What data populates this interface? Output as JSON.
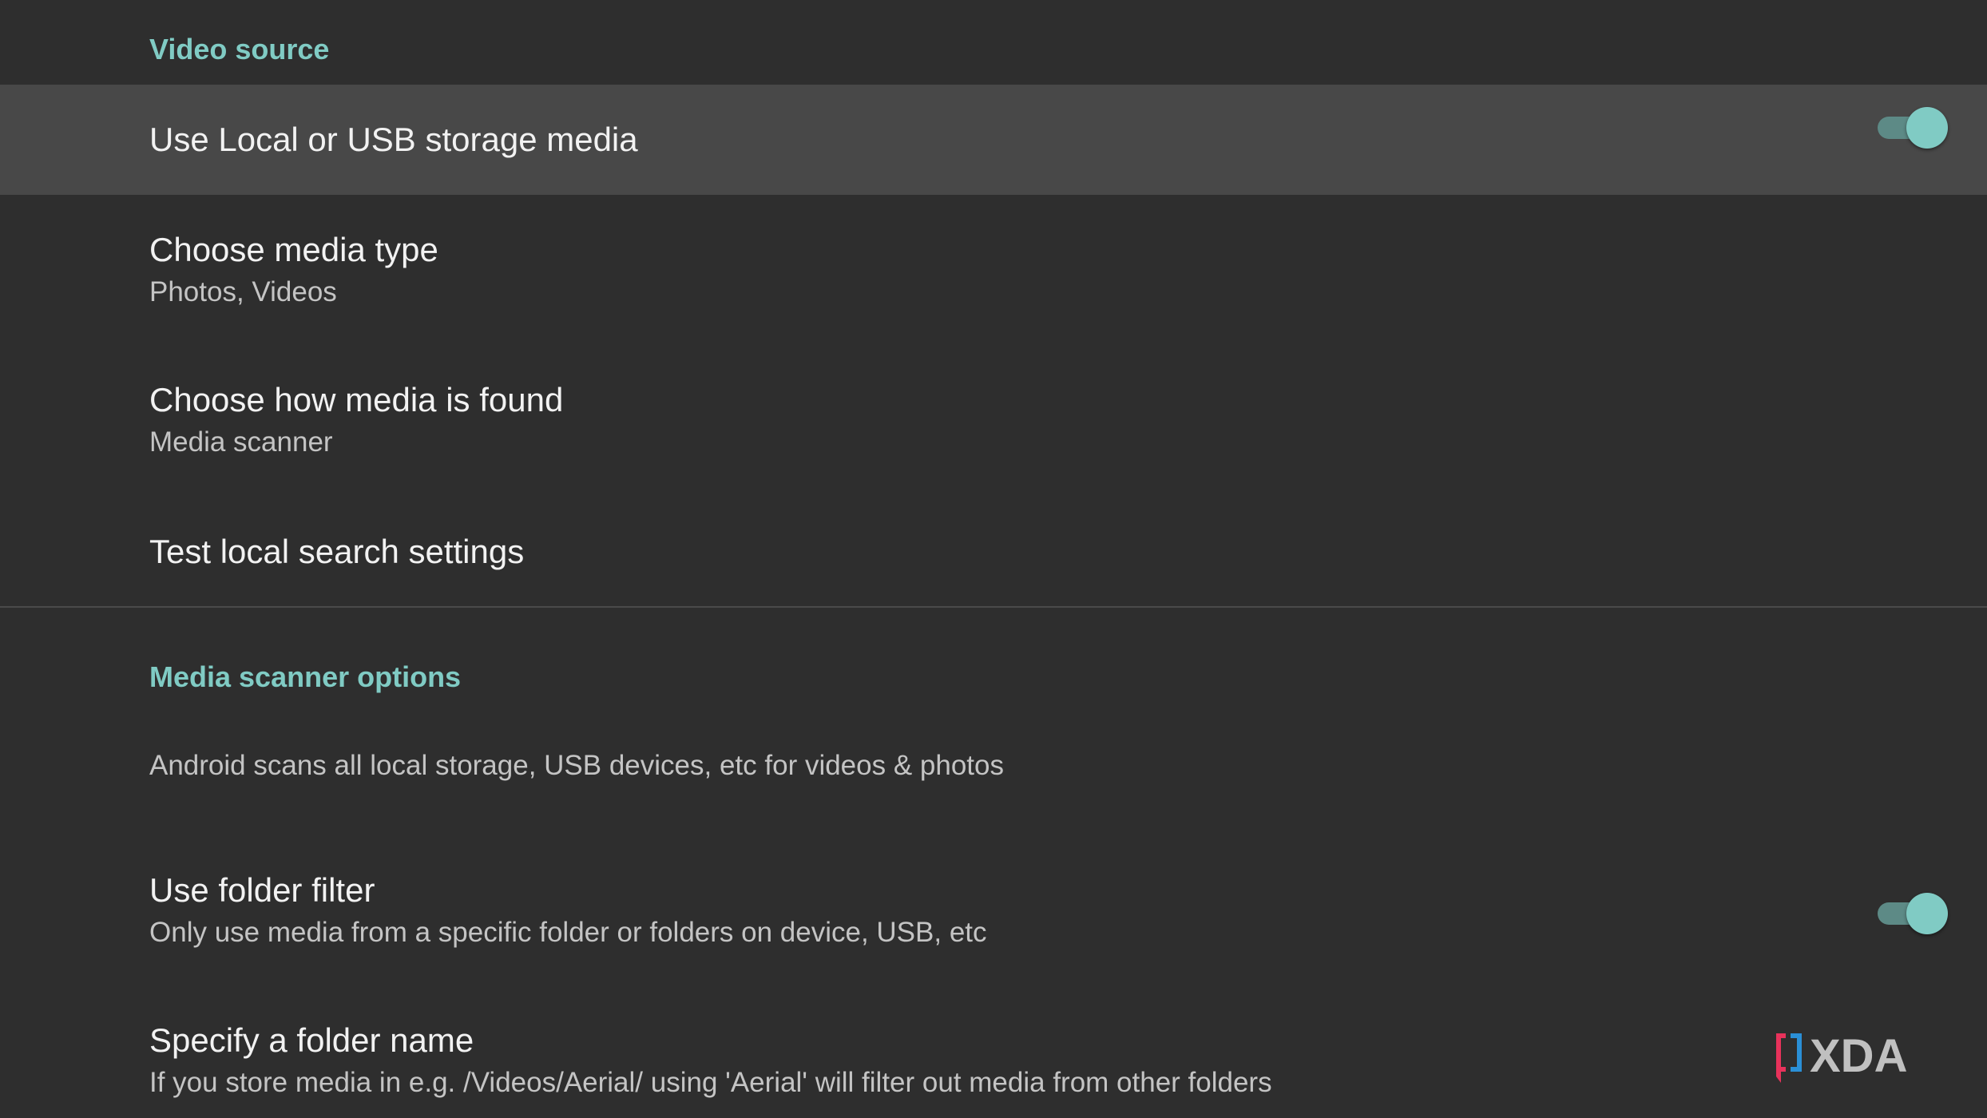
{
  "sections": {
    "video_source": {
      "header": "Video source",
      "local_usb": {
        "title": "Use Local or USB storage media",
        "enabled": true
      },
      "media_type": {
        "title": "Choose media type",
        "summary": "Photos, Videos"
      },
      "media_found": {
        "title": "Choose how media is found",
        "summary": "Media scanner"
      },
      "test_search": {
        "title": "Test local search settings"
      }
    },
    "media_scanner": {
      "header": "Media scanner options",
      "info": "Android scans all local storage, USB devices, etc for videos & photos",
      "folder_filter": {
        "title": "Use folder filter",
        "summary": "Only use media from a specific folder or folders on device, USB, etc",
        "enabled": true
      },
      "folder_name": {
        "title": "Specify a folder name",
        "summary": "If you store media in e.g. /Videos/Aerial/ using 'Aerial' will filter out media from other folders"
      }
    }
  },
  "watermark": {
    "text": "XDA",
    "logo_colors": [
      "#e8325b",
      "#2a8fd6"
    ]
  },
  "colors": {
    "background": "#2e2e2e",
    "focused_row": "#484848",
    "accent": "#80cbc4",
    "toggle_track": "#5d8a86"
  }
}
